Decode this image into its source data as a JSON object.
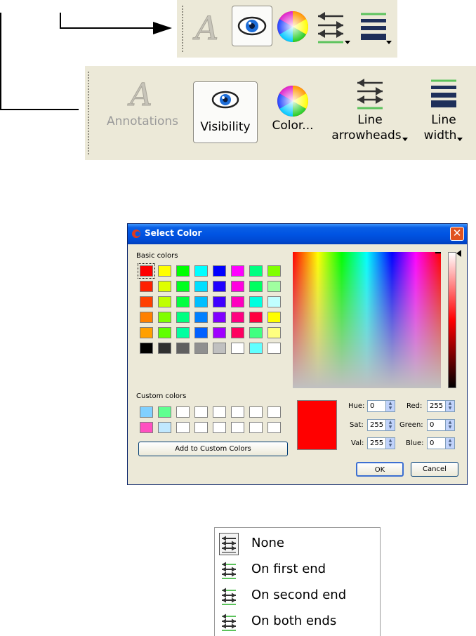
{
  "toolbar_small": {
    "icons": [
      "annotations-icon",
      "visibility-icon",
      "color-wheel-icon",
      "line-arrowheads-icon",
      "line-width-icon"
    ]
  },
  "toolbar_large": {
    "buttons": [
      {
        "label": "Annotations",
        "icon": "annotations-icon",
        "disabled": true
      },
      {
        "label": "Visibility",
        "icon": "visibility-icon",
        "pressed": true
      },
      {
        "label": "Color...",
        "icon": "color-wheel-icon"
      },
      {
        "label": "Line",
        "label2": "arrowheads",
        "icon": "line-arrowheads-icon",
        "dropdown": true
      },
      {
        "label": "Line",
        "label2": "width",
        "icon": "line-width-icon",
        "dropdown": true
      }
    ]
  },
  "dialog": {
    "title": "Select Color",
    "basic_colors_label": "Basic colors",
    "custom_colors_label": "Custom colors",
    "basic_colors": [
      [
        "#ff0000",
        "#ffff00",
        "#00ff00",
        "#00ffff",
        "#0000ff",
        "#ff00ff",
        "#00ff80",
        "#80ff00"
      ],
      [
        "#ff2000",
        "#dfff00",
        "#00ff20",
        "#00dfff",
        "#2000ff",
        "#ff00df",
        "#00ff60",
        "#a0ffa0"
      ],
      [
        "#ff4000",
        "#bfff00",
        "#00ff40",
        "#00bfff",
        "#4000ff",
        "#ff00bf",
        "#00ffdf",
        "#c0ffff"
      ],
      [
        "#ff8000",
        "#80ff00",
        "#00ff80",
        "#0080ff",
        "#8000ff",
        "#ff0080",
        "#ff0040",
        "#ffff00"
      ],
      [
        "#ffa000",
        "#60ff00",
        "#00ffa0",
        "#0060ff",
        "#a000ff",
        "#ff0060",
        "#40ff80",
        "#ffff80"
      ],
      [
        "#000000",
        "#303030",
        "#606060",
        "#909090",
        "#c0c0c0",
        "#ffffff",
        "#60ffff",
        "#ffffff"
      ]
    ],
    "custom_colors": [
      [
        "#80d0ff",
        "#60ff90",
        "#ffffff",
        "#ffffff",
        "#ffffff",
        "#ffffff",
        "#ffffff",
        "#ffffff"
      ],
      [
        "#ff50c0",
        "#c0e8ff",
        "#ffffff",
        "#ffffff",
        "#ffffff",
        "#ffffff",
        "#ffffff",
        "#ffffff"
      ]
    ],
    "add_custom_label": "Add to Custom Colors",
    "current_color": "#ff0000",
    "hue_label": "Hue:",
    "hue": "0",
    "sat_label": "Sat:",
    "sat": "255",
    "val_label": "Val:",
    "val": "255",
    "red_label": "Red:",
    "red": "255",
    "green_label": "Green:",
    "green": "0",
    "blue_label": "Blue:",
    "blue": "0",
    "ok_label": "OK",
    "cancel_label": "Cancel"
  },
  "arrow_menu": {
    "items": [
      {
        "label": "None",
        "icon": "arrowheads-none-icon",
        "checked": true
      },
      {
        "label": "On first end",
        "icon": "arrowheads-first-end-icon"
      },
      {
        "label": "On second end",
        "icon": "arrowheads-second-end-icon"
      },
      {
        "label": "On both ends",
        "icon": "arrowheads-both-ends-icon"
      }
    ]
  },
  "colors": {
    "accent_green": "#5cc35c",
    "line_width_navy": "#1e2f5a",
    "toolbar_bg": "#ECE9D8"
  }
}
